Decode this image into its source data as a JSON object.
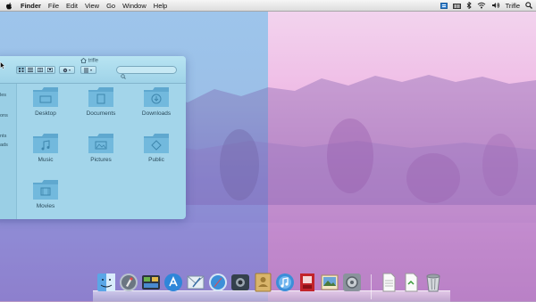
{
  "menubar": {
    "app_name": "Finder",
    "menus": [
      "File",
      "Edit",
      "View",
      "Go",
      "Window",
      "Help"
    ],
    "user_name": "Trifle"
  },
  "finder_window": {
    "title": "trifle",
    "sidebar_items": [
      "les",
      "ons",
      "nts",
      "ads"
    ],
    "items": [
      "Desktop",
      "Documents",
      "Downloads",
      "Music",
      "Pictures",
      "Public",
      "Movies"
    ]
  },
  "dock": {
    "apps": [
      "finder",
      "launchpad",
      "mission-control",
      "app-store",
      "mail",
      "safari",
      "facetime",
      "contacts",
      "itunes",
      "photo-booth",
      "iphoto",
      "system-preferences"
    ],
    "files": [
      "document",
      "document",
      "trash"
    ]
  },
  "colors": {
    "finder_accent": "#a3d5ea",
    "wallpaper_left": "#9bbfe7",
    "wallpaper_right": "#efbde6"
  }
}
